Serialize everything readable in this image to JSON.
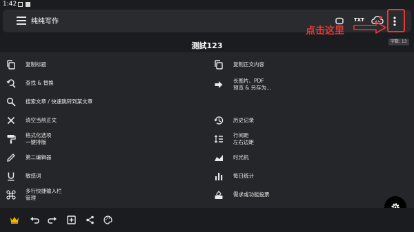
{
  "status_bar": {
    "time": "1:42"
  },
  "app": {
    "title": "纯纯写作"
  },
  "toolbar": {
    "txt_label": "TXT"
  },
  "annotation": {
    "callout_text": "点击这里"
  },
  "word_count": "字数: 13",
  "document": {
    "title": "测試123"
  },
  "menu": {
    "left": [
      {
        "label": "复制标题",
        "icon": "copy-icon"
      },
      {
        "label": "查找 & 替换",
        "icon": "find-replace-icon"
      },
      {
        "label": "搜索文章 / 快速跳转到某文章",
        "icon": "search-icon"
      },
      {
        "label": "清空当前正文",
        "icon": "close-icon"
      },
      {
        "label": "格式化选项\n一键排版",
        "icon": "format-paint-icon"
      },
      {
        "label": "第二编辑器",
        "icon": "pencil-icon"
      },
      {
        "label": "敏感词",
        "icon": "underline-icon"
      },
      {
        "label": "多行快捷输入栏\n管理",
        "icon": "command-icon"
      }
    ],
    "right": [
      {
        "label": "复制正文内容",
        "icon": "copy-icon"
      },
      {
        "label": "长图片、PDF\n预览 & 另存为...",
        "icon": "arrow-right-icon"
      },
      {
        "label": "历史记录",
        "icon": "history-icon"
      },
      {
        "label": "行间距\n左右边距",
        "icon": "line-spacing-icon"
      },
      {
        "label": "时光机",
        "icon": "time-machine-icon"
      },
      {
        "label": "每日统计",
        "icon": "bar-chart-icon"
      },
      {
        "label": "需求或功能投票",
        "icon": "vote-icon"
      }
    ]
  },
  "bottom_bar": {
    "icons": [
      "crown-icon",
      "undo-icon",
      "redo-icon",
      "add-box-icon",
      "share-icon",
      "palette-icon"
    ]
  },
  "colors": {
    "background": "#1b1c1f",
    "panel": "#252629",
    "accent_red": "#e53935",
    "crown": "#f5b400"
  }
}
